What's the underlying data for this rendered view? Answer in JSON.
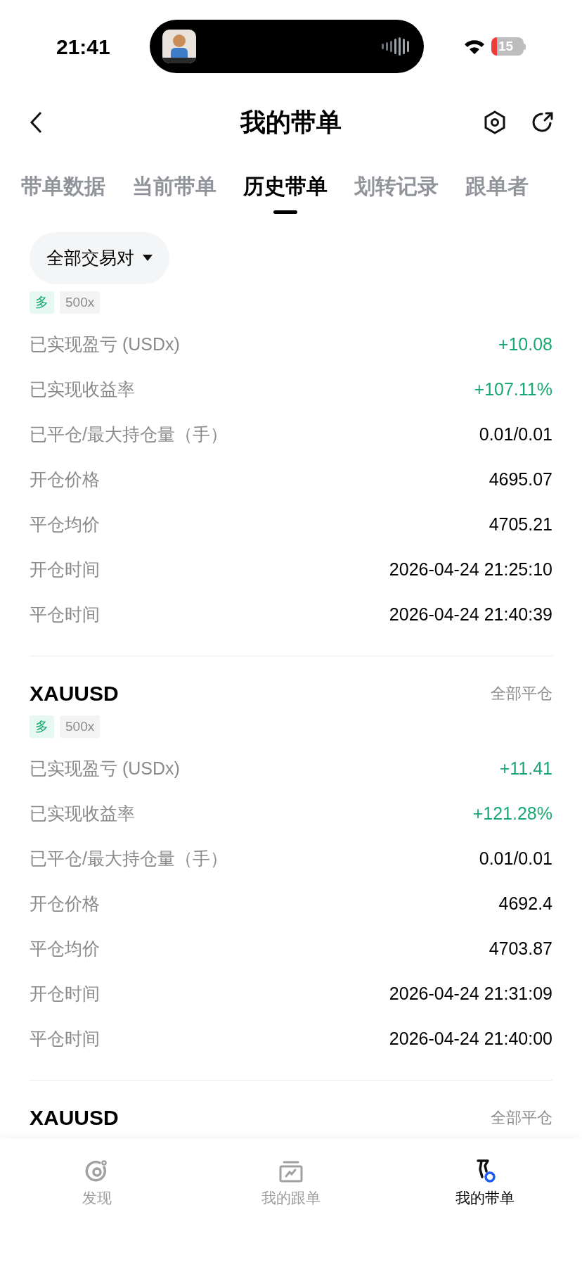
{
  "status_bar": {
    "time": "21:41",
    "battery": "15"
  },
  "header": {
    "title": "我的带单"
  },
  "tabs": [
    {
      "label": "带单数据",
      "selected": false
    },
    {
      "label": "当前带单",
      "selected": false
    },
    {
      "label": "历史带单",
      "selected": true
    },
    {
      "label": "划转记录",
      "selected": false
    },
    {
      "label": "跟单者",
      "selected": false
    }
  ],
  "filter": {
    "label": "全部交易对"
  },
  "orders": [
    {
      "tags": [
        {
          "label": "多",
          "kind": "side"
        },
        {
          "label": "500x",
          "kind": "leverage"
        }
      ],
      "rows": [
        {
          "label": "已实现盈亏 (USDx)",
          "value": "+10.08",
          "kind": "profit"
        },
        {
          "label": "已实现收益率",
          "value": "+107.11%",
          "kind": "profit"
        },
        {
          "label": "已平仓/最大持仓量（手）",
          "value": "0.01/0.01",
          "kind": "plain"
        },
        {
          "label": "开仓价格",
          "value": "4695.07",
          "kind": "plain"
        },
        {
          "label": "平仓均价",
          "value": "4705.21",
          "kind": "plain"
        },
        {
          "label": "开仓时间",
          "value": "2026-04-24 21:25:10",
          "kind": "plain"
        },
        {
          "label": "平仓时间",
          "value": "2026-04-24 21:40:39",
          "kind": "plain"
        }
      ]
    },
    {
      "symbol": "XAUUSD",
      "status": "全部平仓",
      "tags": [
        {
          "label": "多",
          "kind": "side"
        },
        {
          "label": "500x",
          "kind": "leverage"
        }
      ],
      "rows": [
        {
          "label": "已实现盈亏 (USDx)",
          "value": "+11.41",
          "kind": "profit"
        },
        {
          "label": "已实现收益率",
          "value": "+121.28%",
          "kind": "profit"
        },
        {
          "label": "已平仓/最大持仓量（手）",
          "value": "0.01/0.01",
          "kind": "plain"
        },
        {
          "label": "开仓价格",
          "value": "4692.4",
          "kind": "plain"
        },
        {
          "label": "平仓均价",
          "value": "4703.87",
          "kind": "plain"
        },
        {
          "label": "开仓时间",
          "value": "2026-04-24 21:31:09",
          "kind": "plain"
        },
        {
          "label": "平仓时间",
          "value": "2026-04-24 21:40:00",
          "kind": "plain"
        }
      ]
    },
    {
      "symbol": "XAUUSD",
      "status": "全部平仓"
    }
  ],
  "bottom_nav": [
    {
      "label": "发现",
      "kind": "discover",
      "selected": false
    },
    {
      "label": "我的跟单",
      "kind": "follow",
      "selected": false
    },
    {
      "label": "我的带单",
      "kind": "lead",
      "selected": true
    }
  ]
}
